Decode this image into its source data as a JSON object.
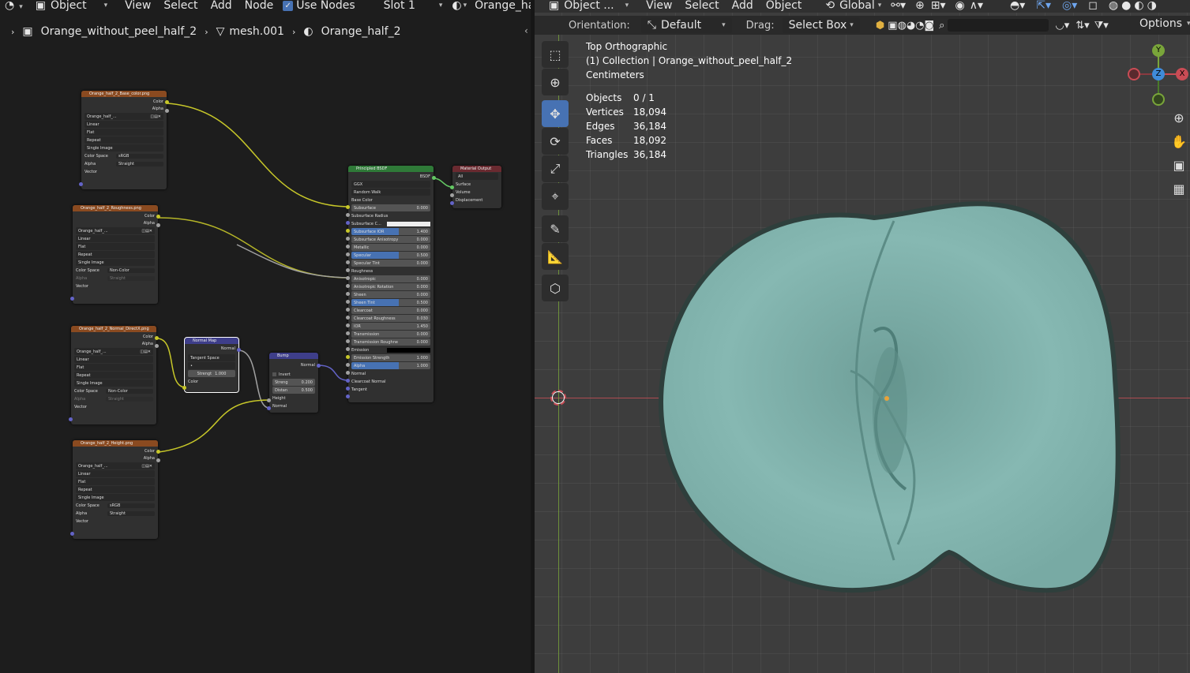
{
  "node_editor": {
    "header": {
      "object_mode": "Object",
      "menus": [
        "View",
        "Select",
        "Add",
        "Node"
      ],
      "use_nodes_label": "Use Nodes",
      "slot": "Slot 1",
      "material": "Orange_half_"
    },
    "breadcrumb": {
      "object": "Orange_without_peel_half_2",
      "mesh": "mesh.001",
      "material": "Orange_half_2"
    },
    "nodes": {
      "base_color": {
        "title": "Orange_half_2_Base_color.png",
        "outputs": [
          "Color",
          "Alpha"
        ],
        "image": "Orange_half_...",
        "interp": "Linear",
        "proj": "Flat",
        "ext": "Repeat",
        "source": "Single Image",
        "cs_label": "Color Space",
        "cs": "sRGB",
        "alpha_label": "Alpha",
        "alpha": "Straight",
        "vector": "Vector"
      },
      "roughness": {
        "title": "Orange_half_2_Roughness.png",
        "outputs": [
          "Color",
          "Alpha"
        ],
        "image": "Orange_half_...",
        "interp": "Linear",
        "proj": "Flat",
        "ext": "Repeat",
        "source": "Single Image",
        "cs_label": "Color Space",
        "cs": "Non-Color",
        "alpha_label": "Alpha",
        "alpha": "Straight",
        "vector": "Vector"
      },
      "normal_tex": {
        "title": "Orange_half_2_Normal_DirectX.png",
        "outputs": [
          "Color",
          "Alpha"
        ],
        "image": "Orange_half_...",
        "interp": "Linear",
        "proj": "Flat",
        "ext": "Repeat",
        "source": "Single Image",
        "cs_label": "Color Space",
        "cs": "Non-Color",
        "alpha_label": "Alpha",
        "alpha": "Straight",
        "vector": "Vector"
      },
      "height": {
        "title": "Orange_half_2_Height.png",
        "outputs": [
          "Color",
          "Alpha"
        ],
        "image": "Orange_half_...",
        "interp": "Linear",
        "proj": "Flat",
        "ext": "Repeat",
        "source": "Single Image",
        "cs_label": "Color Space",
        "cs": "sRGB",
        "alpha_label": "Alpha",
        "alpha": "Straight",
        "vector": "Vector"
      },
      "normal_map": {
        "title": "Normal Map",
        "output": "Normal",
        "space": "Tangent Space",
        "strength_label": "Strengt",
        "strength": "1.000",
        "color": "Color"
      },
      "bump": {
        "title": "Bump",
        "output": "Normal",
        "invert": "Invert",
        "strength_label": "Streng",
        "strength": "0.200",
        "distance_label": "Distan",
        "distance": "0.500",
        "height": "Height",
        "normal": "Normal"
      },
      "bsdf": {
        "title": "Principled BSDF",
        "output": "BSDF",
        "dist": "GGX",
        "sss": "Random Walk",
        "rows": [
          {
            "label": "Base Color",
            "value": ""
          },
          {
            "label": "Subsurface",
            "value": "0.000"
          },
          {
            "label": "Subsurface Radius",
            "value": ""
          },
          {
            "label": "Subsurface C...",
            "value": ""
          },
          {
            "label": "Subsurface IOR",
            "value": "1.400"
          },
          {
            "label": "Subsurface Anisotropy",
            "value": "0.000"
          },
          {
            "label": "Metallic",
            "value": "0.000"
          },
          {
            "label": "Specular",
            "value": "0.500"
          },
          {
            "label": "Specular Tint",
            "value": "0.000"
          },
          {
            "label": "Roughness",
            "value": ""
          },
          {
            "label": "Anisotropic",
            "value": "0.000"
          },
          {
            "label": "Anisotropic Rotation",
            "value": "0.000"
          },
          {
            "label": "Sheen",
            "value": "0.000"
          },
          {
            "label": "Sheen Tint",
            "value": "0.500"
          },
          {
            "label": "Clearcoat",
            "value": "0.000"
          },
          {
            "label": "Clearcoat Roughness",
            "value": "0.030"
          },
          {
            "label": "IOR",
            "value": "1.450"
          },
          {
            "label": "Transmission",
            "value": "0.000"
          },
          {
            "label": "Transmission Roughne",
            "value": "0.000"
          },
          {
            "label": "Emission",
            "value": ""
          },
          {
            "label": "Emission Strength",
            "value": "1.000"
          },
          {
            "label": "Alpha",
            "value": "1.000"
          },
          {
            "label": "Normal",
            "value": ""
          },
          {
            "label": "Clearcoat Normal",
            "value": ""
          },
          {
            "label": "Tangent",
            "value": ""
          }
        ]
      },
      "output": {
        "title": "Material Output",
        "target": "All",
        "inputs": [
          "Surface",
          "Volume",
          "Displacement"
        ]
      }
    }
  },
  "viewport": {
    "header": {
      "mode": "Object ...",
      "menus": [
        "View",
        "Select",
        "Add",
        "Object"
      ],
      "transform": "Global"
    },
    "toolbar2": {
      "orientation_label": "Orientation:",
      "orientation": "Default",
      "drag_label": "Drag:",
      "drag": "Select Box",
      "options": "Options"
    },
    "overlay": {
      "view": "Top Orthographic",
      "collection": "(1) Collection | Orange_without_peel_half_2",
      "units": "Centimeters"
    },
    "stats": [
      {
        "label": "Objects",
        "value": "0 / 1"
      },
      {
        "label": "Vertices",
        "value": "18,094"
      },
      {
        "label": "Edges",
        "value": "36,184"
      },
      {
        "label": "Faces",
        "value": "18,092"
      },
      {
        "label": "Triangles",
        "value": "36,184"
      }
    ],
    "gizmo": {
      "y": "Y",
      "z": "Z",
      "x": "X"
    },
    "colors": {
      "mesh": "#86b8b2",
      "x_axis": "#c94c55",
      "y_axis": "#79a53a",
      "z_axis": "#3f8bd9"
    }
  }
}
